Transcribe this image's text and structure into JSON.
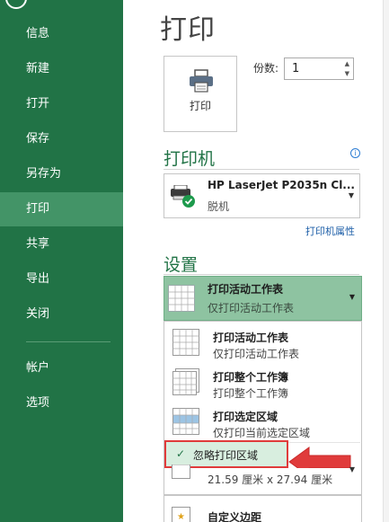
{
  "sidebar": {
    "items": [
      {
        "label": "信息"
      },
      {
        "label": "新建"
      },
      {
        "label": "打开"
      },
      {
        "label": "保存"
      },
      {
        "label": "另存为"
      },
      {
        "label": "打印"
      },
      {
        "label": "共享"
      },
      {
        "label": "导出"
      },
      {
        "label": "关闭"
      },
      {
        "label": "帐户"
      },
      {
        "label": "选项"
      }
    ],
    "active": "打印"
  },
  "main": {
    "title": "打印",
    "print_button_label": "打印",
    "copies_label": "份数:",
    "copies_value": "1"
  },
  "printer": {
    "section_title": "打印机",
    "name": "HP LaserJet P2035n Cl...",
    "status": "脱机",
    "properties_link": "打印机属性"
  },
  "settings": {
    "section_title": "设置",
    "selected": {
      "title": "打印活动工作表",
      "subtitle": "仅打印活动工作表"
    },
    "menu": [
      {
        "title": "打印活动工作表",
        "subtitle": "仅打印活动工作表"
      },
      {
        "title": "打印整个工作簿",
        "subtitle": "打印整个工作簿"
      },
      {
        "title": "打印选定区域",
        "subtitle": "仅打印当前选定区域"
      }
    ],
    "ignore_print_area": "忽略打印区域",
    "paper_size": "21.59 厘米 x 27.94 厘米",
    "margins": "自定义边距"
  },
  "colors": {
    "sidebar": "#217346",
    "sidebar_active": "#439467",
    "accent": "#217346",
    "callout_red": "#e03b3b"
  }
}
